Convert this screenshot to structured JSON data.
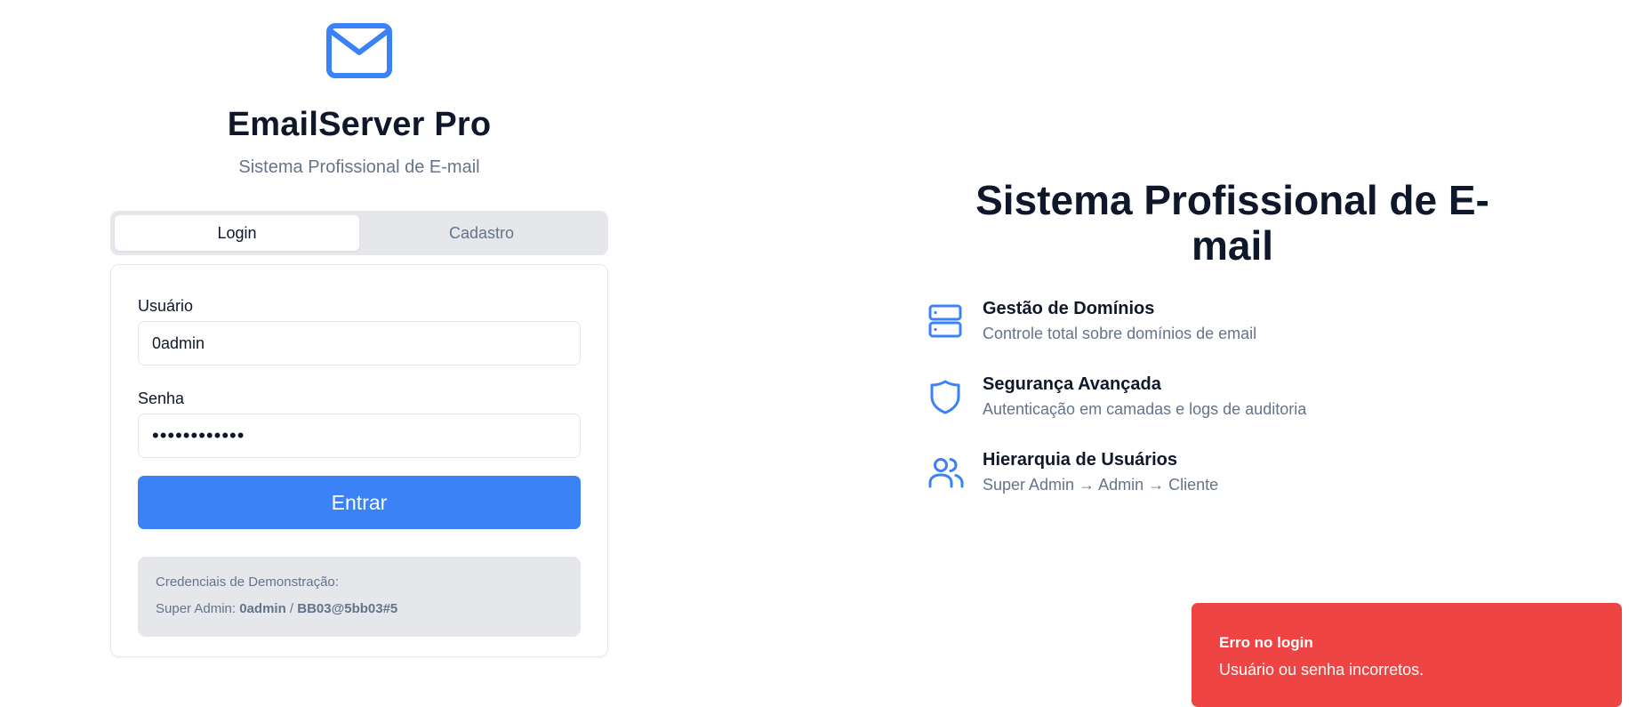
{
  "brand": {
    "icon": "mail-icon",
    "title": "EmailServer Pro",
    "subtitle": "Sistema Profissional de E-mail",
    "accent_color": "#3b82f6"
  },
  "auth_tabs": [
    {
      "label": "Login",
      "active": true
    },
    {
      "label": "Cadastro",
      "active": false
    }
  ],
  "login_form": {
    "username_label": "Usuário",
    "username_value": "0admin",
    "password_label": "Senha",
    "password_value": "••••••••••••",
    "submit_label": "Entrar",
    "demo": {
      "title": "Credenciais de Demonstração:",
      "role_label": "Super Admin:",
      "username": "0admin",
      "separator": "/",
      "password": "BB03@5bb03#5"
    }
  },
  "hero": {
    "title_line1": "Sistema Profissional de E-",
    "title_line2": "mail"
  },
  "features": [
    {
      "icon": "server-icon",
      "title": "Gestão de Domínios",
      "description": "Controle total sobre domínios de email"
    },
    {
      "icon": "shield-icon",
      "title": "Segurança Avançada",
      "description": "Autenticação em camadas e logs de auditoria"
    },
    {
      "icon": "users-icon",
      "title": "Hierarquia de Usuários",
      "description": "Super Admin → Admin → Cliente"
    }
  ],
  "toast": {
    "title": "Erro no login",
    "message": "Usuário ou senha incorretos.",
    "color": "#ef4444"
  }
}
